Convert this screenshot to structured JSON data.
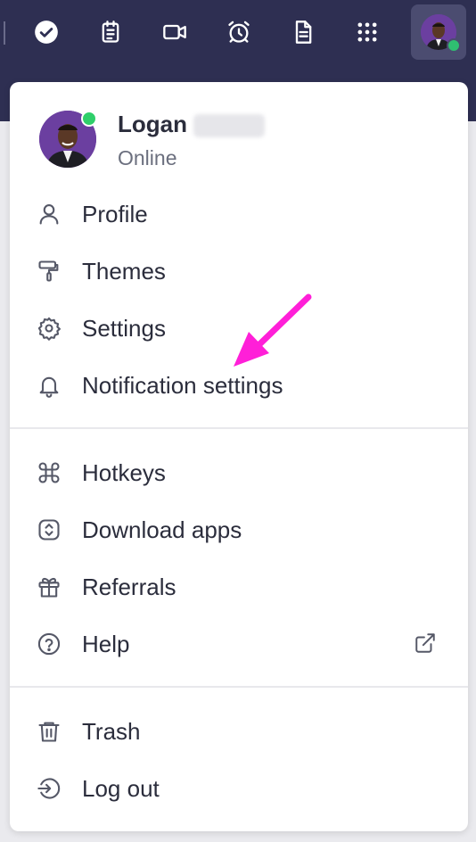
{
  "topbar": {
    "icons": [
      "check-circle-icon",
      "clipboard-icon",
      "video-icon",
      "alarm-clock-icon",
      "document-icon",
      "apps-grid-icon"
    ]
  },
  "user": {
    "name": "Logan",
    "status": "Online",
    "status_color": "#2fcf6a"
  },
  "menu": {
    "section1": [
      {
        "label": "Profile",
        "icon": "person-icon"
      },
      {
        "label": "Themes",
        "icon": "paint-roller-icon"
      },
      {
        "label": "Settings",
        "icon": "gear-icon"
      },
      {
        "label": "Notification settings",
        "icon": "bell-icon"
      }
    ],
    "section2": [
      {
        "label": "Hotkeys",
        "icon": "command-icon"
      },
      {
        "label": "Download apps",
        "icon": "download-apps-icon"
      },
      {
        "label": "Referrals",
        "icon": "gift-icon"
      },
      {
        "label": "Help",
        "icon": "help-circle-icon"
      }
    ],
    "section3": [
      {
        "label": "Trash",
        "icon": "trash-icon"
      },
      {
        "label": "Log out",
        "icon": "logout-icon"
      }
    ]
  },
  "colors": {
    "topbar": "#2e2f52",
    "annotation_arrow": "#ff1fd8"
  }
}
